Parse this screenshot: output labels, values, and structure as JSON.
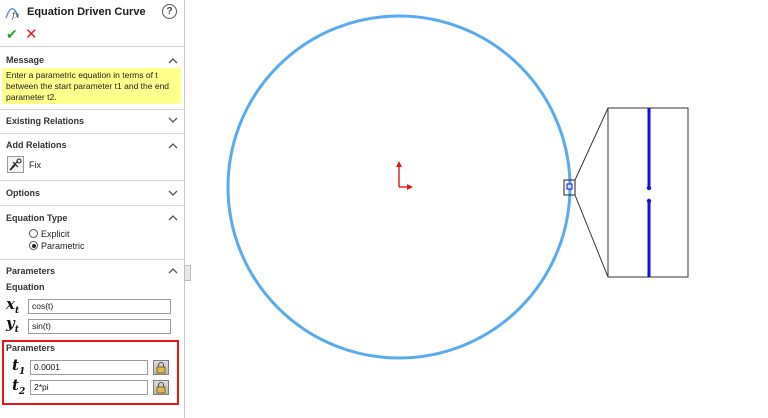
{
  "panel": {
    "title": "Equation Driven Curve",
    "help_label": "?",
    "ok_label": "✔",
    "cancel_label": "✕",
    "message": {
      "title": "Message",
      "text": "Enter a parametric equation in terms of t between the start parameter t1 and the end parameter t2."
    },
    "existing_relations": {
      "title": "Existing Relations"
    },
    "add_relations": {
      "title": "Add Relations",
      "fix_label": "Fix"
    },
    "options": {
      "title": "Options"
    },
    "equation_type": {
      "title": "Equation Type",
      "explicit_label": "Explicit",
      "parametric_label": "Parametric",
      "selected": "Parametric"
    },
    "parameters": {
      "title": "Parameters",
      "equation_label": "Equation",
      "x_var": "x",
      "y_var": "y",
      "t_sub": "t",
      "x_value": "cos(t)",
      "y_value": "sin(t)",
      "params_label": "Parameters",
      "t_var": "t",
      "t1_sub": "1",
      "t2_sub": "2",
      "t1_value": "0.0001",
      "t2_value": "2*pi"
    }
  },
  "colors": {
    "curve": "#5aaaf0",
    "zoom_curve": "#1010e0",
    "origin": "#e01818",
    "highlight_box": "#e01818",
    "message_bg": "#ffff8c"
  }
}
